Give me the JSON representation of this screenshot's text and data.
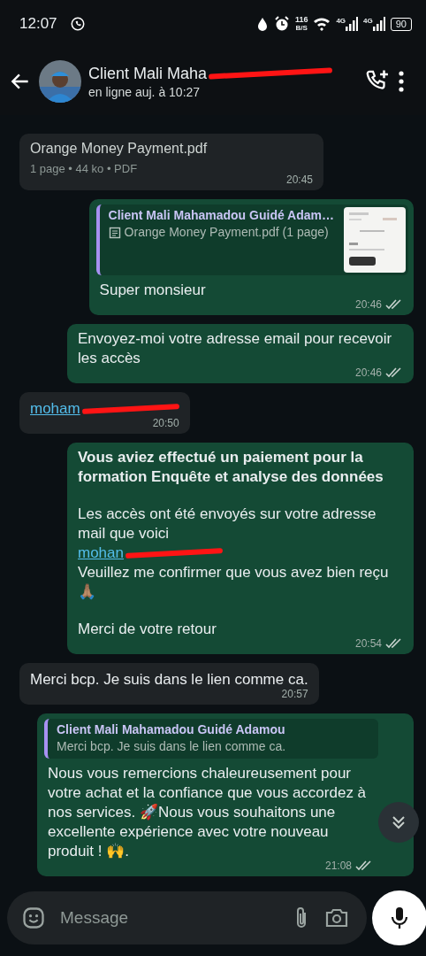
{
  "status_bar": {
    "time": "12:07",
    "speed": "116",
    "speed_unit": "B/S",
    "networks": [
      "4G",
      "4G"
    ],
    "battery": "90"
  },
  "header": {
    "name": "Client Mali Maha",
    "name_redacted": true,
    "status": "en ligne auj. à 10:27"
  },
  "messages": [
    {
      "kind": "document",
      "outgoing": false,
      "filename": "Orange Money Payment.pdf",
      "meta": "1 page • 44 ko • PDF",
      "time": "20:45"
    },
    {
      "kind": "text",
      "outgoing": true,
      "quote": {
        "author": "Client Mali Mahamadou Guidé Adam…",
        "text": "Orange Money Payment.pdf (1 page)",
        "document": true
      },
      "parts": [
        {
          "kind": "text",
          "text": "Super monsieur"
        }
      ],
      "time": "20:46"
    },
    {
      "kind": "text",
      "outgoing": true,
      "parts": [
        {
          "kind": "text",
          "text": "Envoyez-moi votre adresse email pour recevoir les accès"
        }
      ],
      "time": "20:46"
    },
    {
      "kind": "text",
      "outgoing": false,
      "parts": [
        {
          "kind": "link",
          "text": "moham",
          "redacted": true
        }
      ],
      "time": "20:50"
    },
    {
      "kind": "text",
      "outgoing": true,
      "parts": [
        {
          "kind": "bold",
          "text": "Vous aviez effectué un paiement pour la formation Enquête et analyse des données"
        },
        {
          "kind": "text",
          "text": "Les accès ont été envoyés sur votre adresse mail que voici",
          "blank_before": true
        },
        {
          "kind": "link",
          "text": "mohan",
          "redacted": true
        },
        {
          "kind": "text",
          "text": "Veuillez me confirmer que vous avez bien reçu 🙏🏽"
        },
        {
          "kind": "text",
          "text": "Merci de votre retour",
          "blank_before": true
        }
      ],
      "time": "20:54"
    },
    {
      "kind": "text",
      "outgoing": false,
      "parts": [
        {
          "kind": "text",
          "text": "Merci bcp. Je suis dans le lien comme ca."
        }
      ],
      "time": "20:57"
    },
    {
      "kind": "text",
      "outgoing": true,
      "quote": {
        "author": "Client Mali Mahamadou Guidé Adamou",
        "text": "Merci bcp. Je suis dans le lien comme ca."
      },
      "parts": [
        {
          "kind": "text",
          "text": "Nous vous remercions chaleureusement pour votre achat et la confiance que vous accordez à nos services. 🚀Nous vous souhaitons une excellente expérience avec votre nouveau produit ! 🙌."
        }
      ],
      "time": "21:08"
    }
  ],
  "composer": {
    "placeholder": "Message"
  }
}
